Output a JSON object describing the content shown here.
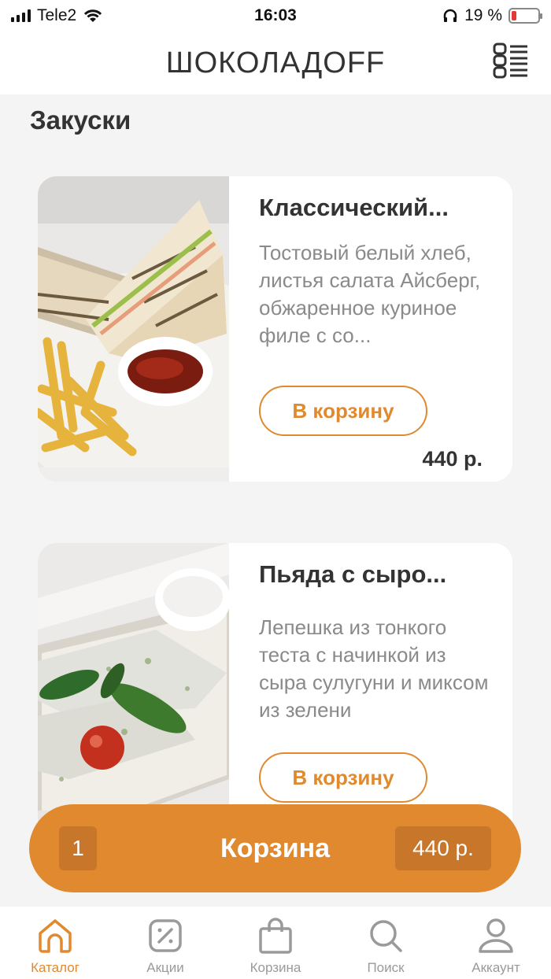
{
  "status_bar": {
    "carrier": "Tele2",
    "time": "16:03",
    "battery": "19 %"
  },
  "header": {
    "title": "ШОКОЛАДOFF"
  },
  "section": {
    "title": "Закуски"
  },
  "products": [
    {
      "name": "Классический...",
      "description": "Тостовый белый хлеб, листья салата Айсберг, обжаренное куриное филе с со...",
      "button": "В корзину",
      "price": "440 р."
    },
    {
      "name": "Пьяда с сыро...",
      "description": "Лепешка из тонкого теста с начинкой из сыра сулугуни и миксом из зелени",
      "button": "В корзину",
      "price": ""
    }
  ],
  "cart_bar": {
    "count": "1",
    "label": "Корзина",
    "total": "440 р."
  },
  "tabs": [
    {
      "label": "Каталог",
      "icon": "home-icon",
      "active": true
    },
    {
      "label": "Акции",
      "icon": "percent-icon",
      "active": false
    },
    {
      "label": "Корзина",
      "icon": "bag-icon",
      "active": false
    },
    {
      "label": "Поиск",
      "icon": "search-icon",
      "active": false
    },
    {
      "label": "Аккаунт",
      "icon": "user-icon",
      "active": false
    }
  ],
  "colors": {
    "accent": "#e0892e",
    "accent_dark": "#c8762a",
    "inactive": "#9a9a9a"
  }
}
